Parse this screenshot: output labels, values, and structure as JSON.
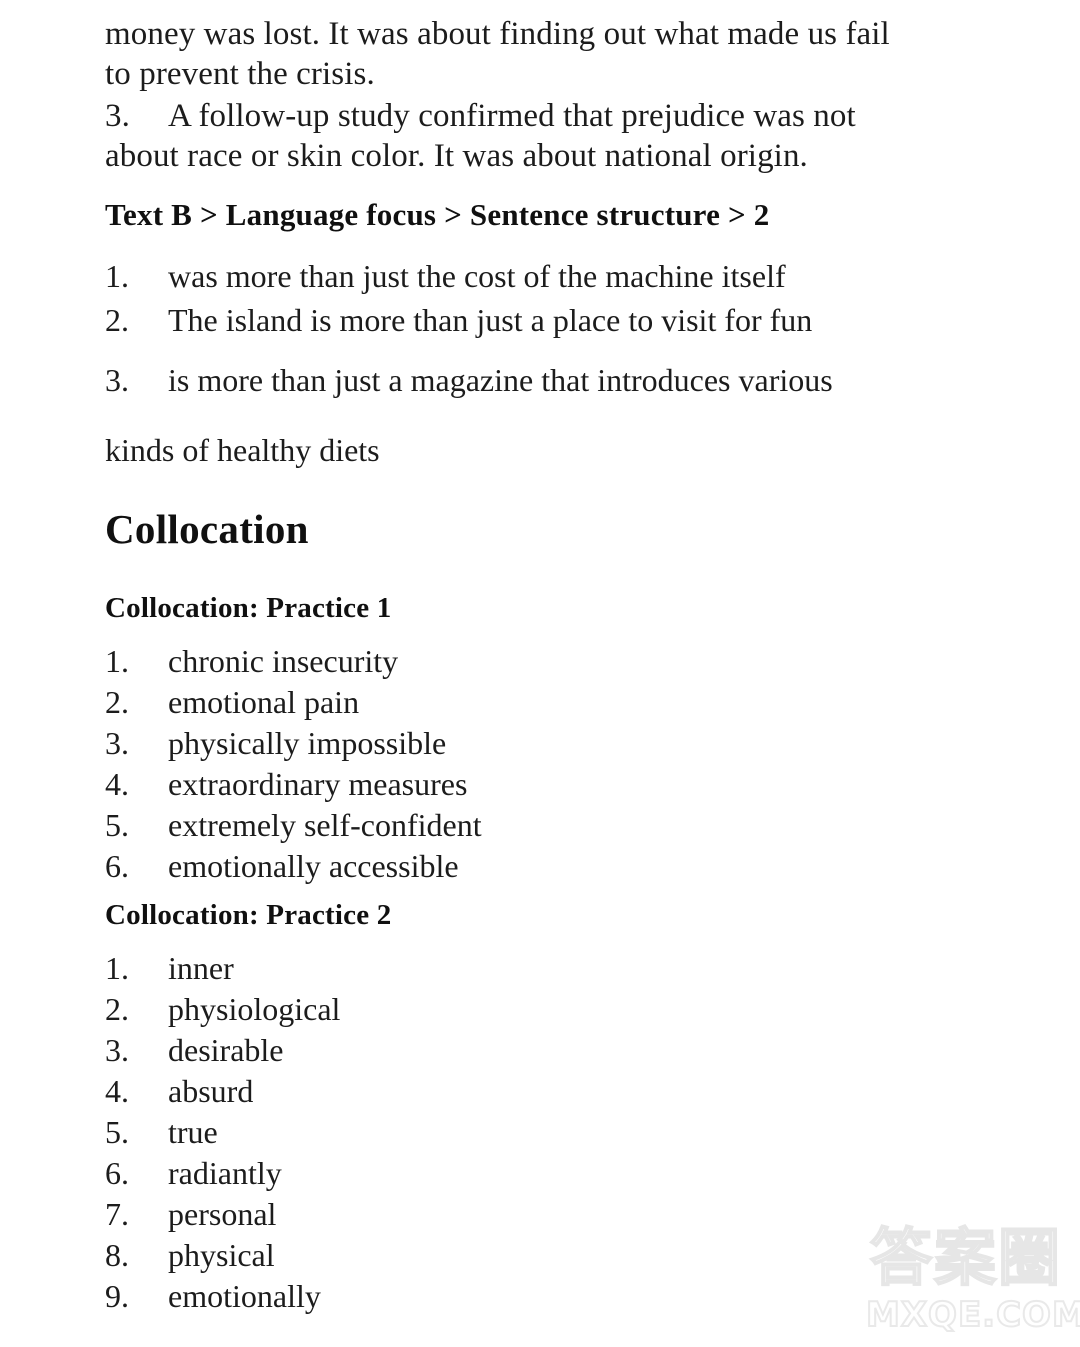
{
  "page": {
    "background_color": "#ffffff",
    "text_color": "#1c1c1c"
  },
  "top_paragraph": {
    "lines": [
      "money was lost. It was about finding out what made us fail",
      "to prevent the crisis."
    ]
  },
  "numbered_paragraph": {
    "index": "3.",
    "lines": [
      "A follow-up study confirmed that prejudice was not",
      "about race or skin color. It was about national origin."
    ]
  },
  "sentence_structure": {
    "heading": "Text B > Language focus > Sentence structure > 2",
    "items": [
      {
        "index": "1.",
        "text": "was more than just the cost of the machine itself"
      },
      {
        "index": "2.",
        "text": "The island is more than just a place to visit for fun"
      },
      {
        "index": "3.",
        "text": "is more than just a magazine that introduces various"
      }
    ],
    "continuation": "kinds of healthy diets"
  },
  "collocation": {
    "heading": "Collocation",
    "practice_1": {
      "heading": "Collocation: Practice 1",
      "items": [
        {
          "index": "1.",
          "text": "chronic insecurity"
        },
        {
          "index": "2.",
          "text": "emotional pain"
        },
        {
          "index": "3.",
          "text": "physically impossible"
        },
        {
          "index": "4.",
          "text": "extraordinary measures"
        },
        {
          "index": "5.",
          "text": "extremely self-confident"
        },
        {
          "index": "6.",
          "text": "emotionally accessible"
        }
      ]
    },
    "practice_2": {
      "heading": "Collocation: Practice 2",
      "items": [
        {
          "index": "1.",
          "text": "inner"
        },
        {
          "index": "2.",
          "text": "physiological"
        },
        {
          "index": "3.",
          "text": "desirable"
        },
        {
          "index": "4.",
          "text": "absurd"
        },
        {
          "index": "5.",
          "text": "true"
        },
        {
          "index": "6.",
          "text": "radiantly"
        },
        {
          "index": "7.",
          "text": "personal"
        },
        {
          "index": "8.",
          "text": "physical"
        },
        {
          "index": "9.",
          "text": "emotionally"
        }
      ]
    }
  },
  "watermark": {
    "cjk_text": "答案圈",
    "domain_text": "MXQE.COM",
    "stroke_color": "#e7e7e7"
  }
}
